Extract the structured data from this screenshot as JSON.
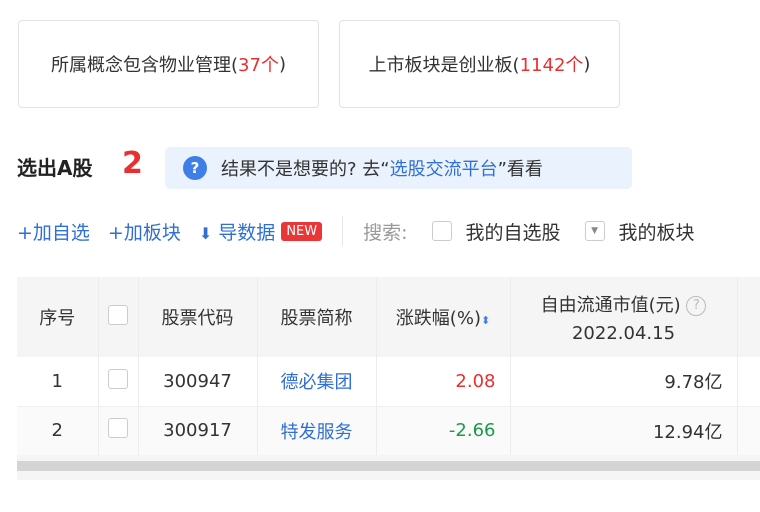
{
  "cards": [
    {
      "text": "所属概念包含物业管理(",
      "count": "37个",
      "close": ")"
    },
    {
      "text": "上市板块是创业板(",
      "count": "1142个",
      "close": ")"
    }
  ],
  "result": {
    "title": "选出A股",
    "count": "2"
  },
  "tip": {
    "prefix": "结果不是想要的? 去“",
    "link": "选股交流平台",
    "suffix": "”看看"
  },
  "toolbar": {
    "add_watch": "+加自选",
    "add_sector": "+加板块",
    "export": "导数据",
    "new_badge": "NEW",
    "search_label": "搜索:",
    "my_watch": "我的自选股",
    "my_sector": "我的板块"
  },
  "table": {
    "headers": [
      "序号",
      "",
      "股票代码",
      "股票简称",
      "涨跌幅(%)",
      "自由流通市值(元)"
    ],
    "header_date": "2022.04.15",
    "rows": [
      {
        "idx": "1",
        "code": "300947",
        "name": "德必集团",
        "change": "2.08",
        "cap": "9.78亿"
      },
      {
        "idx": "2",
        "code": "300917",
        "name": "特发服务",
        "change": "-2.66",
        "cap": "12.94亿"
      }
    ]
  },
  "colors": {
    "accent": "#2f6fd6",
    "up": "#e93030",
    "down": "#1a9a4a"
  }
}
